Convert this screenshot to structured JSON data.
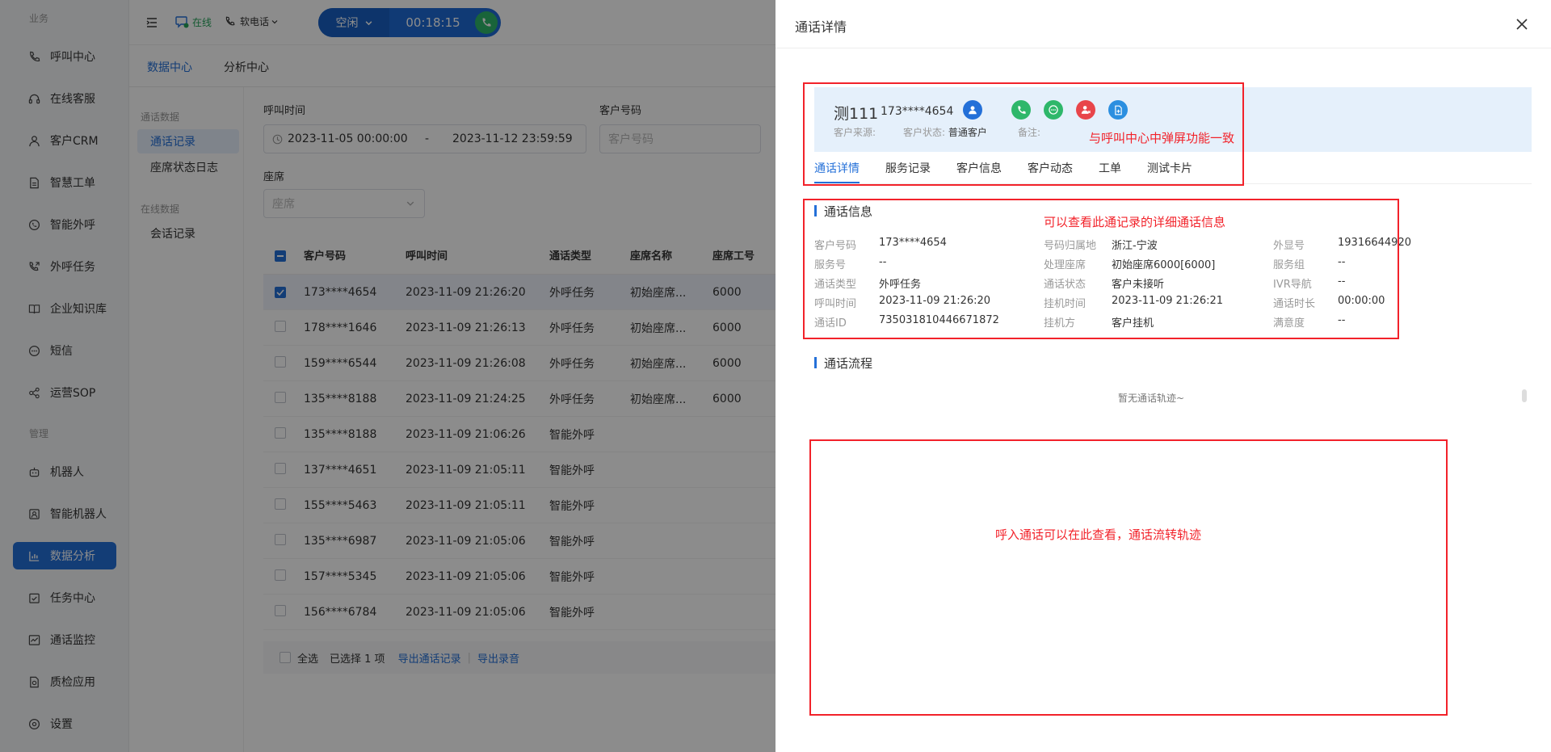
{
  "sidebar": {
    "group_business": "业务",
    "group_manage": "管理",
    "items": [
      {
        "label": "呼叫中心",
        "icon": "phone-icon"
      },
      {
        "label": "在线客服",
        "icon": "headset-icon"
      },
      {
        "label": "客户CRM",
        "icon": "user-icon"
      },
      {
        "label": "智慧工单",
        "icon": "document-icon"
      },
      {
        "label": "智能外呼",
        "icon": "whatsapp-phone-icon"
      },
      {
        "label": "外呼任务",
        "icon": "outbound-call-icon"
      },
      {
        "label": "企业知识库",
        "icon": "book-icon"
      },
      {
        "label": "短信",
        "icon": "message-icon"
      },
      {
        "label": "运营SOP",
        "icon": "flow-icon"
      },
      {
        "label": "机器人",
        "icon": "robot-icon"
      },
      {
        "label": "智能机器人",
        "icon": "smart-robot-icon"
      },
      {
        "label": "数据分析",
        "icon": "bar-chart-icon"
      },
      {
        "label": "任务中心",
        "icon": "task-icon"
      },
      {
        "label": "通话监控",
        "icon": "monitor-icon"
      },
      {
        "label": "质检应用",
        "icon": "quality-icon"
      },
      {
        "label": "设置",
        "icon": "gear-icon"
      }
    ]
  },
  "topbar": {
    "online_status": "在线",
    "phone_type": "软电话",
    "call_status": "空闲",
    "call_timer": "00:18:15"
  },
  "subnav": {
    "tabs": [
      "数据中心",
      "分析中心"
    ]
  },
  "mini_menu": {
    "group_call": "通话数据",
    "group_online": "在线数据",
    "items": [
      "通话记录",
      "座席状态日志",
      "会话记录"
    ]
  },
  "filters": {
    "call_time_label": "呼叫时间",
    "start": "2023-11-05 00:00:00",
    "separator": "-",
    "end": "2023-11-12 23:59:59",
    "customer_number_label": "客户号码",
    "customer_number_placeholder": "客户号码",
    "seat_label": "座席",
    "seat_placeholder": "座席"
  },
  "table": {
    "headers": [
      "客户号码",
      "呼叫时间",
      "通话类型",
      "座席名称",
      "座席工号"
    ],
    "rows": [
      {
        "num": "173****4654",
        "time": "2023-11-09 21:26:20",
        "type": "外呼任务",
        "seat": "初始座席...",
        "no": "6000",
        "checked": true
      },
      {
        "num": "178****1646",
        "time": "2023-11-09 21:26:13",
        "type": "外呼任务",
        "seat": "初始座席...",
        "no": "6000",
        "checked": false
      },
      {
        "num": "159****6544",
        "time": "2023-11-09 21:26:08",
        "type": "外呼任务",
        "seat": "初始座席...",
        "no": "6000",
        "checked": false
      },
      {
        "num": "135****8188",
        "time": "2023-11-09 21:24:25",
        "type": "外呼任务",
        "seat": "初始座席...",
        "no": "6000",
        "checked": false
      },
      {
        "num": "135****8188",
        "time": "2023-11-09 21:06:26",
        "type": "智能外呼",
        "seat": "",
        "no": "",
        "checked": false
      },
      {
        "num": "137****4651",
        "time": "2023-11-09 21:05:11",
        "type": "智能外呼",
        "seat": "",
        "no": "",
        "checked": false
      },
      {
        "num": "155****5463",
        "time": "2023-11-09 21:05:11",
        "type": "智能外呼",
        "seat": "",
        "no": "",
        "checked": false
      },
      {
        "num": "135****6987",
        "time": "2023-11-09 21:05:06",
        "type": "智能外呼",
        "seat": "",
        "no": "",
        "checked": false
      },
      {
        "num": "157****5345",
        "time": "2023-11-09 21:05:06",
        "type": "智能外呼",
        "seat": "",
        "no": "",
        "checked": false
      },
      {
        "num": "156****6784",
        "time": "2023-11-09 21:05:06",
        "type": "智能外呼",
        "seat": "",
        "no": "",
        "checked": false
      }
    ]
  },
  "footer": {
    "select_all": "全选",
    "selected": "已选择 1 项",
    "export_records": "导出通话记录",
    "export_audio": "导出录音"
  },
  "drawer": {
    "title": "通话详情",
    "customer": {
      "name": "测111",
      "phone": "173****4654",
      "source_label": "客户来源:",
      "status_label": "客户状态:",
      "status_value": "普通客户",
      "note_label": "备注:"
    },
    "tabs": [
      "通话详情",
      "服务记录",
      "客户信息",
      "客户动态",
      "工单",
      "测试卡片"
    ],
    "info_title": "通话信息",
    "info": [
      [
        {
          "label": "客户号码",
          "value": "173****4654"
        },
        {
          "label": "号码归属地",
          "value": "浙江-宁波"
        },
        {
          "label": "外显号",
          "value": "19316644920"
        }
      ],
      [
        {
          "label": "服务号",
          "value": "--"
        },
        {
          "label": "处理座席",
          "value": "初始座席6000[6000]"
        },
        {
          "label": "服务组",
          "value": "--"
        }
      ],
      [
        {
          "label": "通话类型",
          "value": "外呼任务"
        },
        {
          "label": "通话状态",
          "value": "客户未接听"
        },
        {
          "label": "IVR导航",
          "value": "--"
        }
      ],
      [
        {
          "label": "呼叫时间",
          "value": "2023-11-09 21:26:20"
        },
        {
          "label": "挂机时间",
          "value": "2023-11-09 21:26:21"
        },
        {
          "label": "通话时长",
          "value": "00:00:00"
        }
      ],
      [
        {
          "label": "通话ID",
          "value": "735031810446671872"
        },
        {
          "label": "挂机方",
          "value": "客户挂机"
        },
        {
          "label": "满意度",
          "value": "--"
        }
      ]
    ],
    "flow_title": "通话流程",
    "flow_empty": "暂无通话轨迹~"
  },
  "annotations": {
    "popup": "与呼叫中心中弹屏功能一致",
    "detail": "可以查看此通记录的详细通话信息",
    "flow": "呼入通话可以在此查看，通话流转轨迹"
  },
  "colors": {
    "primary": "#2470d8",
    "annotation_red": "#f2222a",
    "online_green": "#25a35a",
    "card_bg": "#e5f0fb"
  }
}
